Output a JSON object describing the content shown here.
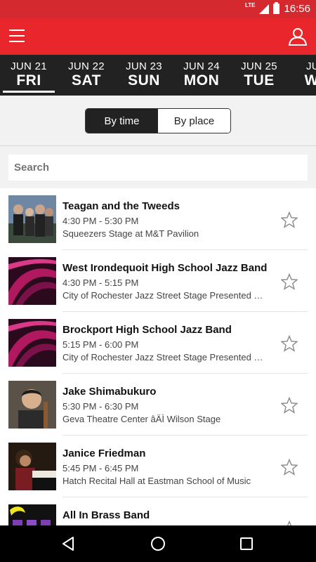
{
  "status_bar": {
    "network": "LTE",
    "time": "16:56"
  },
  "app_bar": {
    "menu_icon": "hamburger-menu-icon",
    "profile_icon": "user-profile-icon"
  },
  "dates": [
    {
      "date": "JUN 21",
      "day": "FRI",
      "active": true
    },
    {
      "date": "JUN 22",
      "day": "SAT",
      "active": false
    },
    {
      "date": "JUN 23",
      "day": "SUN",
      "active": false
    },
    {
      "date": "JUN 24",
      "day": "MON",
      "active": false
    },
    {
      "date": "JUN 25",
      "day": "TUE",
      "active": false
    },
    {
      "date": "JUN",
      "day": "WE",
      "active": false
    }
  ],
  "view_toggle": {
    "by_time": "By time",
    "by_place": "By place",
    "selected": "By time"
  },
  "search": {
    "placeholder": "Search"
  },
  "events": [
    {
      "title": "Teagan and the Tweeds",
      "time": "4:30 PM - 5:30 PM",
      "place": "Squeezers Stage at M&T Pavilion",
      "thumb": "band-photo"
    },
    {
      "title": "West Irondequoit High School Jazz Band",
      "time": "4:30 PM - 5:15 PM",
      "place": "City of Rochester Jazz Street Stage Presented by Rochester Jazz Festival",
      "thumb": "abstract-magenta"
    },
    {
      "title": "Brockport High School Jazz Band",
      "time": "5:15 PM - 6:00 PM",
      "place": "City of Rochester Jazz Street Stage Presented by Rochester Jazz Festival",
      "thumb": "abstract-magenta"
    },
    {
      "title": "Jake Shimabukuro",
      "time": "5:30 PM - 6:30 PM",
      "place": "Geva Theatre Center âÄÌ Wilson Stage",
      "thumb": "portrait-ukulele"
    },
    {
      "title": "Janice Friedman",
      "time": "5:45 PM - 6:45 PM",
      "place": "Hatch Recital Hall at Eastman School of Music",
      "thumb": "piano-player"
    },
    {
      "title": "All In Brass Band",
      "time": "",
      "place": "",
      "thumb": "purple-yellow-logo"
    }
  ],
  "nav_bar": {
    "back_icon": "back-triangle-icon",
    "home_icon": "home-circle-icon",
    "recents_icon": "recents-square-icon"
  },
  "colors": {
    "app_bar": "#e8262c",
    "status_bar": "#d42a2f",
    "date_strip": "#222222",
    "toggle_active": "#222222"
  }
}
